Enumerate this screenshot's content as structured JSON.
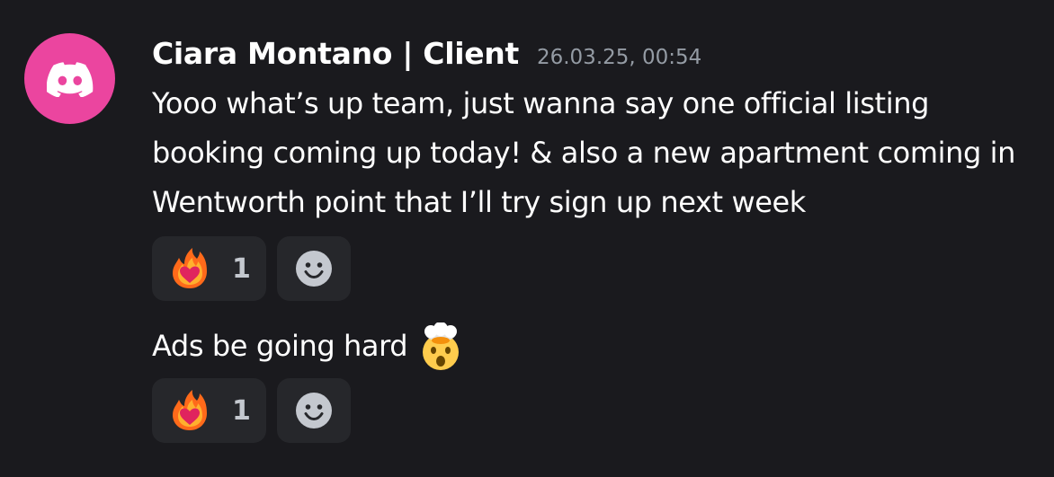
{
  "message": {
    "author": "Ciara Montano | Client",
    "timestamp": "26.03.25, 00:54",
    "avatar_color": "#eb459f",
    "avatar_icon": "discord-logo-icon",
    "text": "Yooo what’s up team, just wanna say one official listing booking coming up today! & also a new apartment coming in Wentworth point that I’ll try sign up next week",
    "reactions": [
      {
        "emoji": "fire-heart-icon",
        "count": "1"
      }
    ],
    "add_reaction_icon": "smiley-icon"
  },
  "followup": {
    "text": "Ads be going hard",
    "emoji": "exploding-head-icon",
    "reactions": [
      {
        "emoji": "fire-heart-icon",
        "count": "1"
      }
    ],
    "add_reaction_icon": "smiley-icon"
  }
}
